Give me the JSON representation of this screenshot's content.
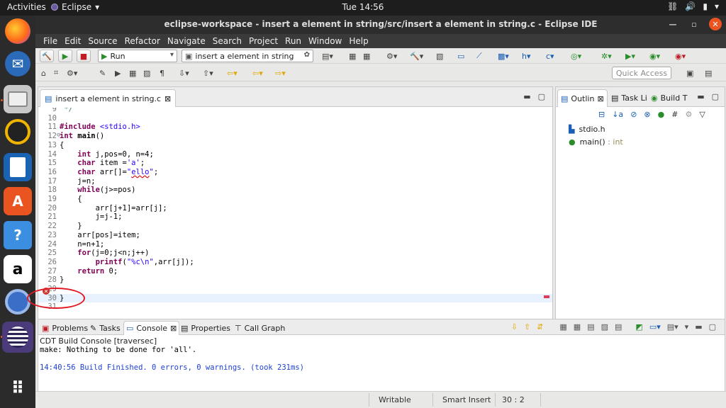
{
  "topbar": {
    "activities": "Activities",
    "app_name": "Eclipse",
    "clock": "Tue 14:56"
  },
  "window": {
    "title": "eclipse-workspace - insert a element in string/src/insert a element in string.c - Eclipse IDE"
  },
  "menu": [
    "File",
    "Edit",
    "Source",
    "Refactor",
    "Navigate",
    "Search",
    "Project",
    "Run",
    "Window",
    "Help"
  ],
  "toolbar": {
    "launch_mode": "Run",
    "launch_config": "insert a element in string",
    "quick_access_placeholder": "Quick Access"
  },
  "editor": {
    "tab_label": "insert a element in string.c",
    "lines": [
      {
        "n": "9",
        "html": "<span class=\"cmt\"> */</span>"
      },
      {
        "n": "10",
        "html": ""
      },
      {
        "n": "11",
        "html": "<span class=\"kw\">#include</span> <span class=\"str\">&lt;stdio.h&gt;</span>"
      },
      {
        "n": "12",
        "html": "<span class=\"kw\">int</span> <b>main</b>()"
      },
      {
        "n": "13",
        "html": "{"
      },
      {
        "n": "14",
        "html": "    <span class=\"kw\">int</span> j,pos=0, n=4;"
      },
      {
        "n": "15",
        "html": "    <span class=\"kw\">char</span> item =<span class=\"str\">'a'</span>;"
      },
      {
        "n": "16",
        "html": "    <span class=\"kw\">char</span> arr[]=<span class=\"str\">\"<span class=\"err-ul\">ello</span>\"</span>;"
      },
      {
        "n": "17",
        "html": "    j=n;"
      },
      {
        "n": "18",
        "html": "    <span class=\"kw\">while</span>(j&gt;=pos)"
      },
      {
        "n": "19",
        "html": "    {"
      },
      {
        "n": "20",
        "html": "        arr[j+1]=arr[j];"
      },
      {
        "n": "21",
        "html": "        j=j-1;"
      },
      {
        "n": "22",
        "html": "    }"
      },
      {
        "n": "23",
        "html": "    arr[pos]=item;"
      },
      {
        "n": "24",
        "html": "    n=n+1;"
      },
      {
        "n": "25",
        "html": "    <span class=\"kw\">for</span>(j=0;j&lt;n;j++)"
      },
      {
        "n": "26",
        "html": "        <span class=\"kw\">printf</span>(<span class=\"str\">\"%c\\n\"</span>,arr[j]);"
      },
      {
        "n": "27",
        "html": "    <span class=\"kw\">return</span> 0;"
      },
      {
        "n": "28",
        "html": "}"
      },
      {
        "n": "29",
        "html": ""
      },
      {
        "n": "30",
        "html": "}"
      },
      {
        "n": "31",
        "html": ""
      }
    ]
  },
  "outline": {
    "tabs": [
      "Outlin",
      "Task Li",
      "Build T"
    ],
    "items": [
      {
        "label": "stdio.h",
        "type": ""
      },
      {
        "label": "main()",
        "type": " : int"
      }
    ]
  },
  "console": {
    "tabs": [
      "Problems",
      "Tasks",
      "Console",
      "Properties",
      "Call Graph"
    ],
    "header": "CDT Build Console [traversec]",
    "lines": [
      {
        "text": "make: Nothing to be done for 'all'.",
        "color": "#000000"
      },
      {
        "text": "",
        "color": "#000000"
      },
      {
        "text": "14:40:56 Build Finished. 0 errors, 0 warnings. (took 231ms)",
        "color": "#1c3fd6"
      }
    ]
  },
  "status": {
    "writable": "Writable",
    "insert_mode": "Smart Insert",
    "position": "30 : 2"
  }
}
